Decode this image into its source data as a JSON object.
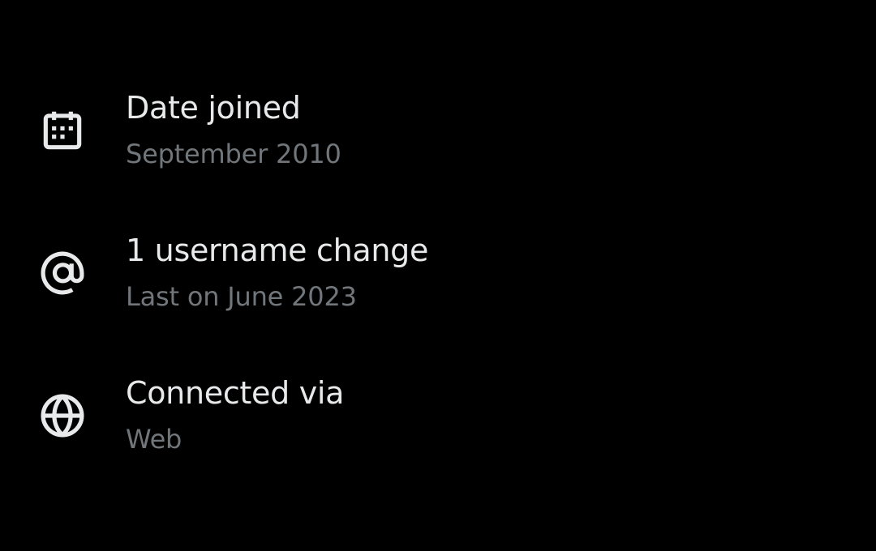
{
  "colors": {
    "background": "#000000",
    "primary_text": "#e7e9ea",
    "secondary_text": "#71767b",
    "icon": "#e7e9ea"
  },
  "items": [
    {
      "icon": "calendar-icon",
      "title": "Date joined",
      "subtitle": "September 2010"
    },
    {
      "icon": "at-sign-icon",
      "title": "1 username change",
      "subtitle": "Last on June 2023"
    },
    {
      "icon": "globe-icon",
      "title": "Connected via",
      "subtitle": "Web"
    }
  ]
}
